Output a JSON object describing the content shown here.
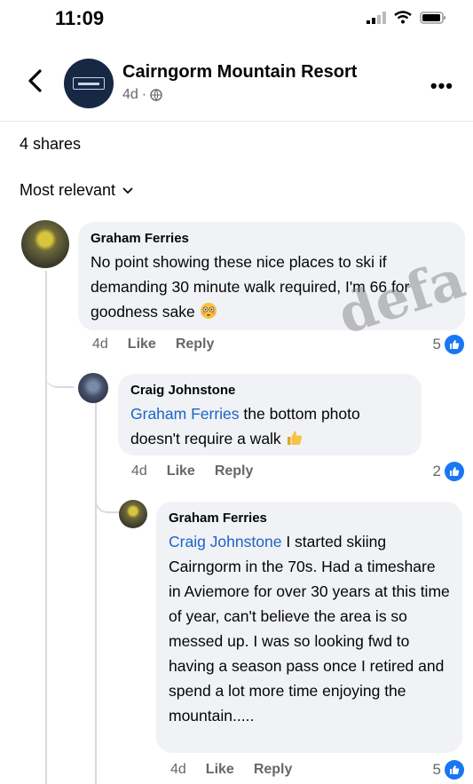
{
  "status_bar": {
    "time": "11:09"
  },
  "post": {
    "page_name": "Cairngorm Mountain Resort",
    "age": "4d",
    "separator": "·"
  },
  "shares": "4 shares",
  "sort": {
    "label": "Most relevant"
  },
  "comments": [
    {
      "author": "Graham Ferries",
      "text": "No point showing these nice places to ski if demanding 30 minute walk required, I'm 66 for goodness sake",
      "time": "4d",
      "like": "Like",
      "reply": "Reply",
      "reactions": "5"
    },
    {
      "author": "Craig Johnstone",
      "mention": "Graham Ferries",
      "text": " the bottom photo doesn't require a walk",
      "time": "4d",
      "like": "Like",
      "reply": "Reply",
      "reactions": "2"
    },
    {
      "author": "Graham Ferries",
      "mention": "Craig Johnstone",
      "text": " I started skiing Cairngorm in the 70s. Had a timeshare in Aviemore for over 30 years at this time of year, can't believe the area is so messed up. I was so looking fwd to having a season pass once I retired and spend a lot more time enjoying the mountain.....",
      "time": "4d",
      "like": "Like",
      "reply": "Reply",
      "reactions": "5"
    }
  ],
  "watermark": "defa",
  "colors": {
    "accent": "#1877f2",
    "mention": "#1b64c8",
    "bubble": "#f0f2f5"
  }
}
